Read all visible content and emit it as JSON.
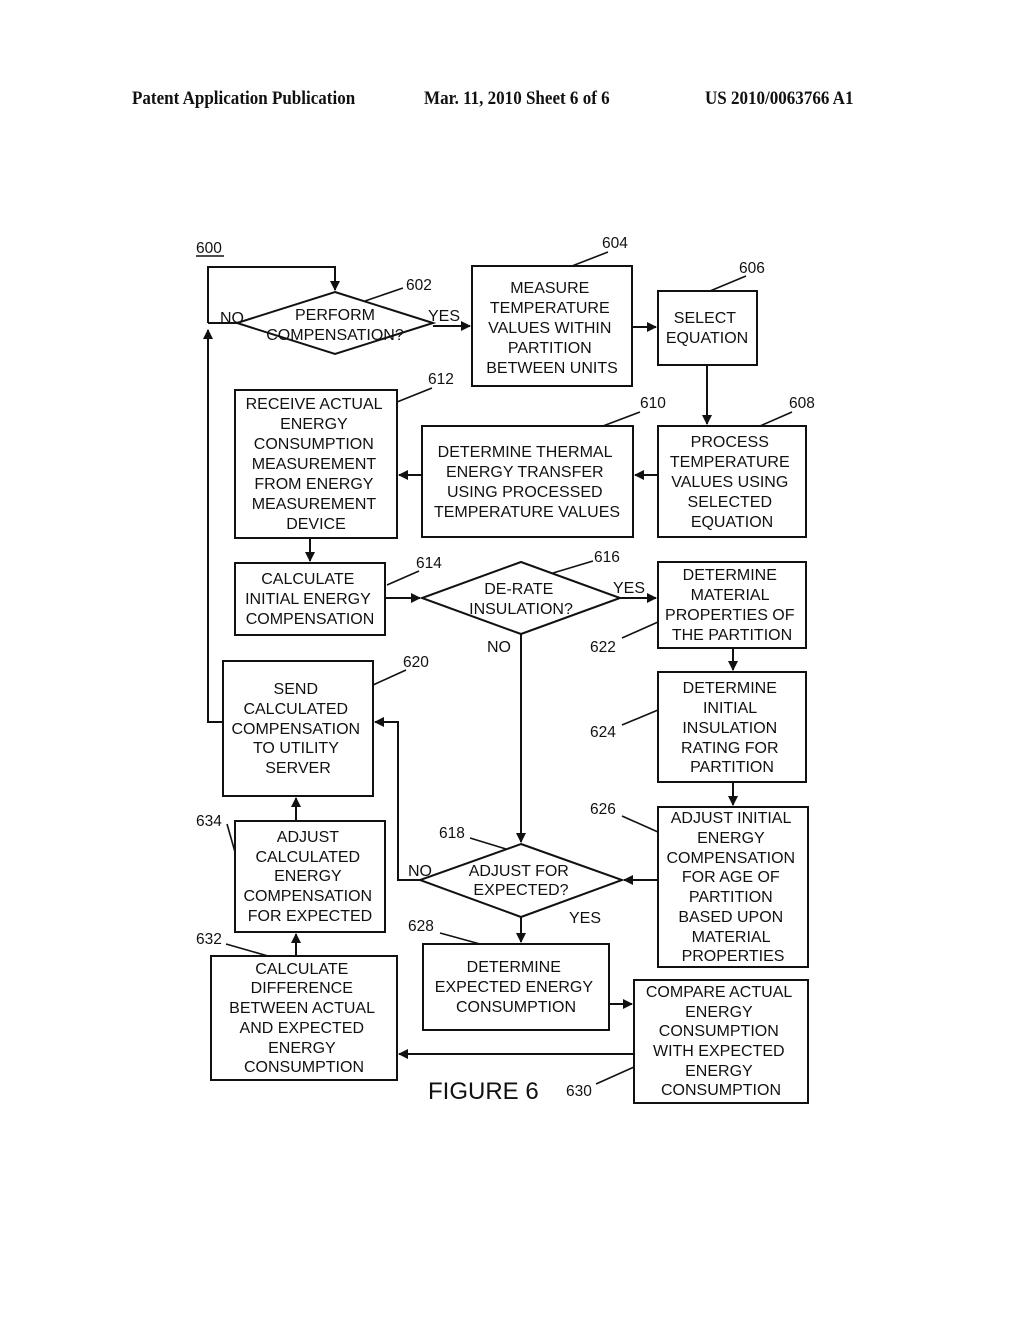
{
  "header": {
    "publication": "Patent Application Publication",
    "date_sheet": "Mar. 11, 2010  Sheet 6 of 6",
    "number": "US 2010/0063766 A1"
  },
  "figure": {
    "id_label": "600",
    "caption": "FIGURE 6",
    "nodes": {
      "n602": {
        "ref": "602",
        "type": "decision",
        "lines": [
          "PERFORM",
          "COMPENSATION?"
        ]
      },
      "n604": {
        "ref": "604",
        "type": "process",
        "lines": [
          "MEASURE",
          "TEMPERATURE",
          "VALUES WITHIN",
          "PARTITION",
          "BETWEEN UNITS"
        ]
      },
      "n606": {
        "ref": "606",
        "type": "process",
        "lines": [
          "SELECT",
          "EQUATION"
        ]
      },
      "n608": {
        "ref": "608",
        "type": "process",
        "lines": [
          "PROCESS",
          "TEMPERATURE",
          "VALUES USING",
          "SELECTED",
          "EQUATION"
        ]
      },
      "n610": {
        "ref": "610",
        "type": "process",
        "lines": [
          "DETERMINE THERMAL",
          "ENERGY TRANSFER",
          "USING PROCESSED",
          "TEMPERATURE VALUES"
        ]
      },
      "n612": {
        "ref": "612",
        "type": "process",
        "lines": [
          "RECEIVE ACTUAL",
          "ENERGY",
          "CONSUMPTION",
          "MEASUREMENT",
          "FROM ENERGY",
          "MEASUREMENT",
          "DEVICE"
        ]
      },
      "n614": {
        "ref": "614",
        "type": "process",
        "lines": [
          "CALCULATE",
          "INITIAL ENERGY",
          "COMPENSATION"
        ]
      },
      "n616": {
        "ref": "616",
        "type": "decision",
        "lines": [
          "DE-RATE",
          "INSULATION?"
        ]
      },
      "n618": {
        "ref": "618",
        "type": "decision",
        "lines": [
          "ADJUST FOR",
          "EXPECTED?"
        ]
      },
      "n620": {
        "ref": "620",
        "type": "process",
        "lines": [
          "SEND",
          "CALCULATED",
          "COMPENSATION",
          "TO UTILITY",
          "SERVER"
        ]
      },
      "n622": {
        "ref": "622",
        "type": "process",
        "lines": [
          "DETERMINE",
          "MATERIAL",
          "PROPERTIES OF",
          "THE PARTITION"
        ]
      },
      "n624": {
        "ref": "624",
        "type": "process",
        "lines": [
          "DETERMINE",
          "INITIAL",
          "INSULATION",
          "RATING FOR",
          "PARTITION"
        ]
      },
      "n626": {
        "ref": "626",
        "type": "process",
        "lines": [
          "ADJUST INITIAL",
          "ENERGY",
          "COMPENSATION",
          "FOR AGE OF",
          "PARTITION",
          "BASED UPON",
          "MATERIAL",
          "PROPERTIES"
        ]
      },
      "n628": {
        "ref": "628",
        "type": "process",
        "lines": [
          "DETERMINE",
          "EXPECTED ENERGY",
          "CONSUMPTION"
        ]
      },
      "n630": {
        "ref": "630",
        "type": "process",
        "lines": [
          "COMPARE ACTUAL",
          "ENERGY",
          "CONSUMPTION",
          "WITH EXPECTED",
          "ENERGY",
          "CONSUMPTION"
        ]
      },
      "n632": {
        "ref": "632",
        "type": "process",
        "lines": [
          "CALCULATE",
          "DIFFERENCE",
          "BETWEEN ACTUAL",
          "AND EXPECTED",
          "ENERGY",
          "CONSUMPTION"
        ]
      },
      "n634": {
        "ref": "634",
        "type": "process",
        "lines": [
          "ADJUST",
          "CALCULATED",
          "ENERGY",
          "COMPENSATION",
          "FOR EXPECTED"
        ]
      }
    },
    "edge_labels": {
      "e602_yes": "YES",
      "e602_no": "NO",
      "e616_yes": "YES",
      "e616_no": "NO",
      "e618_yes": "YES",
      "e618_no": "NO"
    }
  }
}
